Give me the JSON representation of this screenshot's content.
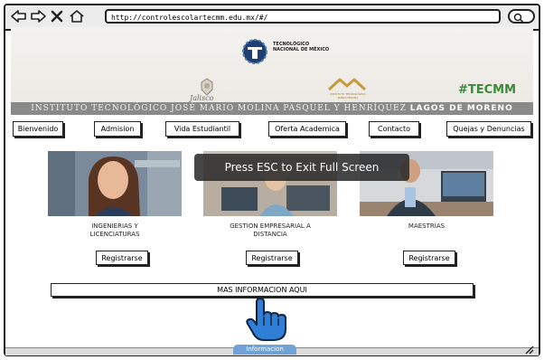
{
  "browser": {
    "url": "http://controlescolartecmm.edu.mx/#/"
  },
  "banner": {
    "tec_name_line1": "TECNOLÓGICO",
    "tec_name_line2": "NACIONAL DE MÉXICO",
    "jalisco": "Jalisco",
    "ministry_line1": "INSTITUTO TECNOLÓGICO",
    "ministry_line2": "MARIO MOLINA",
    "hashtag": "#TECMM",
    "institute_prefix": "INSTITUTO TECNOLÓGICO JOSÉ MARIO MOLINA PASQUEL Y HENRÍQUEZ ",
    "institute_campus": "LAGOS DE MORENO"
  },
  "nav": {
    "items": [
      "Bienvenido",
      "Admision",
      "Vida Estudiantil",
      "Oferta Academica",
      "Contacto",
      "Quejas y Denuncias"
    ]
  },
  "cards": [
    {
      "label_line1": "INGENIERIAS Y",
      "label_line2": "LICENCIATURAS",
      "button": "Registrarse"
    },
    {
      "label_line1": "GESTION EMPRESARIAL A",
      "label_line2": "DISTANCIA",
      "button": "Registrarse"
    },
    {
      "label_line1": "MAESTRÍAS",
      "label_line2": "",
      "button": "Registrarse"
    }
  ],
  "fullscreen_notice": "Press ESC to Exit Full Screen",
  "more_info_button": "MAS INFORMACION AQUI",
  "info_tab": "Informacion",
  "colors": {
    "hashtag": "#3a8a3a",
    "institute_bar": "#8a8a8a",
    "info_tab": "#6fa3d8",
    "hand": "#2f7fd6"
  }
}
